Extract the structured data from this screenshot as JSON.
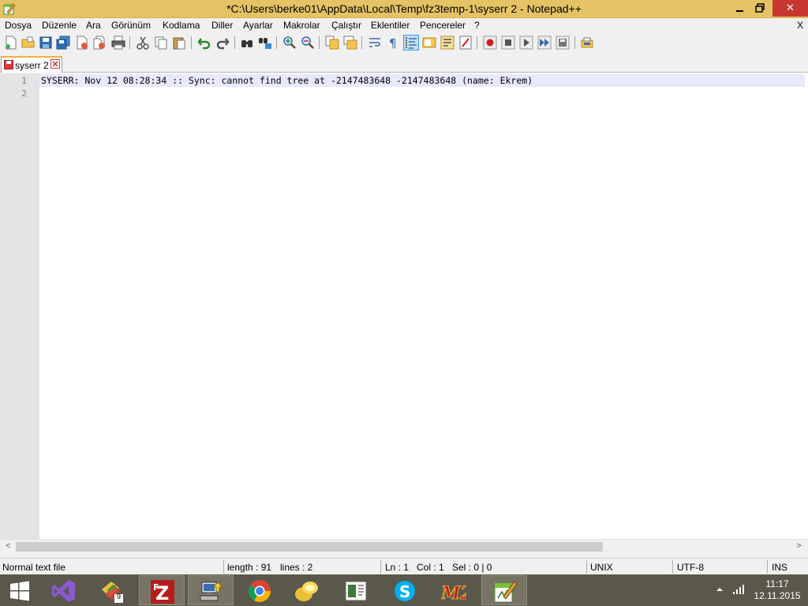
{
  "window": {
    "title": "*C:\\Users\\berke01\\AppData\\Local\\Temp\\fz3temp-1\\syserr 2 - Notepad++",
    "minimize_icon": "minimize-icon",
    "maximize_icon": "restore-icon",
    "close_label": "✕"
  },
  "menu": {
    "items": [
      "Dosya",
      "Düzenle",
      "Ara",
      "Görünüm",
      "Kodlama",
      "Diller",
      "Ayarlar",
      "Makrolar",
      "Çalıştır",
      "Eklentiler",
      "Pencereler",
      "?"
    ],
    "close_label": "X"
  },
  "toolbar": {
    "icons": [
      "new-file-icon",
      "open-file-icon",
      "save-icon",
      "save-all-icon",
      "close-icon",
      "close-all-icon",
      "print-icon",
      "cut-icon",
      "copy-icon",
      "paste-icon",
      "undo-icon",
      "redo-icon",
      "find-icon",
      "replace-icon",
      "zoom-in-icon",
      "zoom-out-icon",
      "sync-vertical-icon",
      "sync-horizontal-icon",
      "word-wrap-icon",
      "show-all-chars-icon",
      "indent-guide-icon",
      "doc-map-icon",
      "function-list-icon",
      "folder-as-workspace-icon",
      "record-macro-icon",
      "stop-macro-icon",
      "play-macro-icon",
      "run-macro-multiple-icon",
      "save-macro-icon",
      "plugin-icon"
    ]
  },
  "tabs": [
    {
      "label": "syserr 2",
      "icon": "unsaved-file-icon",
      "close_icon": "tab-close-icon"
    }
  ],
  "editor": {
    "line_numbers": [
      "1",
      "2"
    ],
    "lines": [
      "SYSERR: Nov 12 08:28:34 :: Sync: cannot find tree at -2147483648 -2147483648 (name: Ekrem)",
      ""
    ]
  },
  "scrollbar": {
    "left_arrow": "<",
    "right_arrow": ">"
  },
  "statusbar": {
    "file_type": "Normal text file",
    "length": "length : 91",
    "lines": "lines : 2",
    "ln": "Ln : 1",
    "col": "Col : 1",
    "sel": "Sel : 0 | 0",
    "eol": "UNIX",
    "encoding": "UTF-8",
    "mode": "INS"
  },
  "taskbar": {
    "items": [
      "windows-start-icon",
      "visual-studio-icon",
      "app-badge-icon",
      "filezilla-icon",
      "network-icon",
      "chrome-icon",
      "folder-app-icon",
      "document-viewer-icon",
      "skype-icon",
      "m2-app-icon",
      "notepadpp-icon"
    ],
    "badge": "9",
    "clock_time": "11:17",
    "clock_date": "12.11.2015",
    "tray_icons": [
      "tray-up-arrow-icon",
      "signal-icon"
    ]
  },
  "colors": {
    "titlebar": "#e5c365",
    "close_button": "#c7372f",
    "line_highlight": "#e8e8ff",
    "gutter": "#e4e4e4",
    "taskbar": "#5a574b"
  }
}
